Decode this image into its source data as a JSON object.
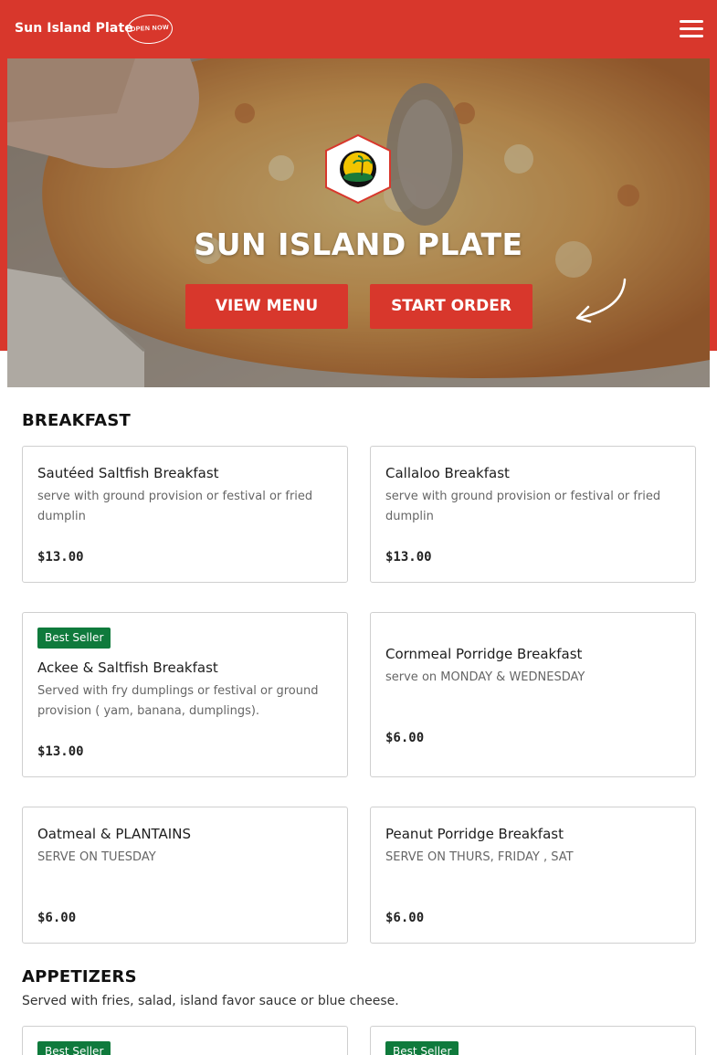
{
  "header": {
    "brand": "Sun Island Plate",
    "open_badge": "OPEN NOW"
  },
  "hero": {
    "title": "SUN ISLAND PLATE",
    "view_menu_label": "VIEW MENU",
    "start_order_label": "START ORDER"
  },
  "sections": [
    {
      "title": "BREAKFAST",
      "items": [
        {
          "name": "Sautéed Saltfish Breakfast",
          "desc": "serve with ground provision or festival or fried dumplin",
          "price": "$13.00"
        },
        {
          "name": "Callaloo Breakfast",
          "desc": "serve with ground provision or festival or fried dumplin",
          "price": "$13.00"
        },
        {
          "badge": "Best Seller",
          "name": "Ackee & Saltfish Breakfast",
          "desc": "Served with fry dumplings or festival or ground provision ( yam, banana, dumplings).",
          "price": "$13.00"
        },
        {
          "name": "Cornmeal Porridge Breakfast",
          "desc": "serve on MONDAY & WEDNESDAY",
          "price": "$6.00"
        },
        {
          "name": "Oatmeal & PLANTAINS",
          "desc": "SERVE ON TUESDAY",
          "price": "$6.00"
        },
        {
          "name": "Peanut Porridge Breakfast",
          "desc": "SERVE ON THURS, FRIDAY , SAT",
          "price": "$6.00"
        }
      ]
    },
    {
      "title": "APPETIZERS",
      "desc": "Served with fries, salad, island favor sauce or blue cheese.",
      "items": [
        {
          "badge": "Best Seller"
        },
        {
          "badge": "Best Seller"
        }
      ]
    }
  ],
  "colors": {
    "brand_red": "#d8372c",
    "badge_green": "#0f7a3c"
  }
}
